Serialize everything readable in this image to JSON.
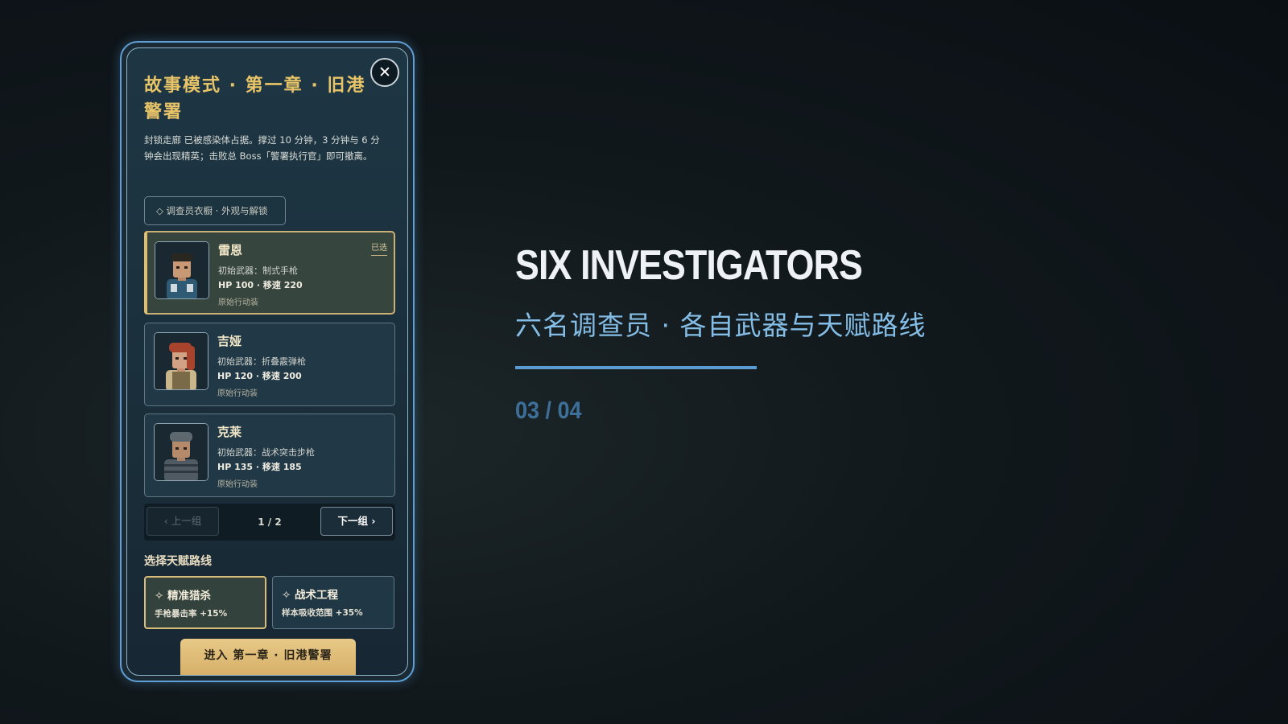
{
  "panel": {
    "title": "故事模式 · 第一章 · 旧港警署",
    "description": "封锁走廊 已被感染体占据。撑过 10 分钟，3 分钟与 6 分钟会出现精英；击败总 Boss「警署执行官」即可撤离。",
    "close_label": "✕",
    "wardrobe_label": "◇ 调查员衣橱 · 外观与解锁"
  },
  "characters": [
    {
      "name": "雷恩",
      "weapon": "初始武器：制式手枪",
      "stats": "HP 100 · 移速 220",
      "outfit": "原始行动装",
      "badge": "已选",
      "selected": true,
      "portrait": "blue-jacket-investigator"
    },
    {
      "name": "吉娅",
      "weapon": "初始武器：折叠霰弹枪",
      "stats": "HP 120 · 移速 200",
      "outfit": "原始行动装",
      "badge": "",
      "selected": false,
      "portrait": "red-hair-investigator"
    },
    {
      "name": "克莱",
      "weapon": "初始武器：战术突击步枪",
      "stats": "HP 135 · 移速 185",
      "outfit": "原始行动装",
      "badge": "",
      "selected": false,
      "portrait": "armored-soldier"
    }
  ],
  "pager": {
    "prev_label": "‹ 上一组",
    "count": "1 / 2",
    "next_label": "下一组 ›",
    "prev_disabled": true
  },
  "talents": {
    "heading": "选择天赋路线",
    "options": [
      {
        "name": "✧ 精准猎杀",
        "desc": "手枪暴击率 +15%",
        "selected": true
      },
      {
        "name": "✧ 战术工程",
        "desc": "样本吸收范围 +35%",
        "selected": false
      }
    ]
  },
  "enter_button": "进入 第一章 · 旧港警署",
  "hero": {
    "title": "SIX INVESTIGATORS",
    "subtitle": "六名调查员 · 各自武器与天赋路线",
    "page": "03 / 04"
  },
  "colors": {
    "accent_gold": "#e8c468",
    "frame_blue": "#5f9fd6",
    "subtitle_blue": "#84bde6"
  }
}
